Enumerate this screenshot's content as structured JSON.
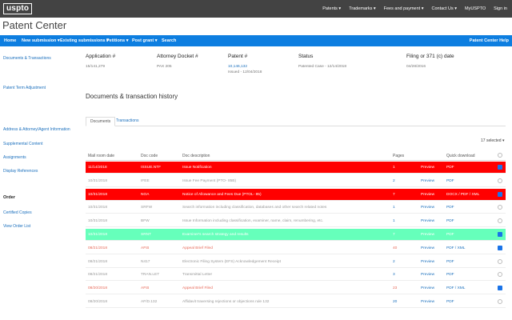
{
  "header": {
    "logo": "uspto",
    "nav": [
      "Patents ▾",
      "Trademarks ▾",
      "Fees and payment ▾",
      "Contact Us ▾",
      "MyUSPTO",
      "Sign in"
    ]
  },
  "app_title": "Patent Center",
  "mainnav": {
    "home": "Home",
    "new_submission": "New submission ▾",
    "existing_submissions": "Existing submissions ▾",
    "petitions": "Petitions ▾",
    "post_grant": "Post grant ▾",
    "search": "Search",
    "help": "Patent Center Help"
  },
  "sidebar": {
    "documents_transactions": "Documents & Transactions",
    "patent_term_adjustment": "Patent Term Adjustment",
    "address_attorney": "Address & Attorney/Agent Information",
    "supplemental_content": "Supplemental Content",
    "assignments": "Assignments",
    "display_references": "Display References",
    "order_header": "Order",
    "certified_copies": "Certified Copies",
    "view_order_list": "View Order List"
  },
  "summary": {
    "application_label": "Application #",
    "application_value": "15/141,279",
    "docket_label": "Attorney Docket #",
    "docket_value": "PAX 205",
    "patent_label": "Patent #",
    "patent_value": "10,146,132",
    "patent_issued": "Issued - 12/04/2018",
    "status_label": "Status",
    "status_value": "Patented Case - 12/14/2018",
    "filing_label": "Filing or 371 (c) date",
    "filing_value": "04/28/2016"
  },
  "section_title": "Documents & transaction history",
  "tabs": {
    "documents": "Documents",
    "transactions": "Transactions"
  },
  "selected_label": "17 selected ▾",
  "table": {
    "headers": {
      "date": "Mail room date",
      "code": "Doc code",
      "desc": "Doc description",
      "pages": "Pages",
      "download": "Quick download"
    },
    "rows": [
      {
        "date": "11/14/2018",
        "code": "ISSUE.NTF",
        "desc": "Issue Notification",
        "pages": "1",
        "preview": "Preview",
        "dl": "PDF",
        "style": "red",
        "checked": true
      },
      {
        "date": "10/31/2018",
        "code": "IFEE",
        "desc": "Issue Fee Payment (PTO- 85B)",
        "pages": "2",
        "preview": "Preview",
        "dl": "PDF",
        "style": "normal",
        "checked": false
      },
      {
        "date": "10/31/2018",
        "code": "NOA",
        "desc": "Notice of Allowance and Fees Due (PTOL- 85)",
        "pages": "7",
        "preview": "Preview",
        "dl": "DOCX / PDF / XML",
        "style": "red",
        "checked": true
      },
      {
        "date": "10/31/2018",
        "code": "SRFW",
        "desc": "Search information including classification, databases and other search related notes",
        "pages": "1",
        "preview": "Preview",
        "dl": "PDF",
        "style": "normal",
        "checked": false
      },
      {
        "date": "10/31/2018",
        "code": "BFW",
        "desc": "Issue Information including classification, examiner, name, claim, renumbering, etc.",
        "pages": "1",
        "preview": "Preview",
        "dl": "PDF",
        "style": "normal",
        "checked": false
      },
      {
        "date": "10/31/2018",
        "code": "SRNT",
        "desc": "Examiner's search strategy and results",
        "pages": "7",
        "preview": "Preview",
        "dl": "PDF",
        "style": "green",
        "checked": true
      },
      {
        "date": "08/21/2018",
        "code": "AP.B",
        "desc": "Appeal Brief Filed",
        "pages": "40",
        "preview": "Preview",
        "dl": "PDF / XML",
        "style": "appeal",
        "checked": true
      },
      {
        "date": "08/21/2018",
        "code": "N417",
        "desc": "Electronic Filing System (EFS) Acknowledgement Receipt",
        "pages": "2",
        "preview": "Preview",
        "dl": "PDF",
        "style": "normal",
        "checked": false
      },
      {
        "date": "08/21/2018",
        "code": "TRAN.LET",
        "desc": "Transmittal Letter",
        "pages": "3",
        "preview": "Preview",
        "dl": "PDF",
        "style": "normal",
        "checked": false
      },
      {
        "date": "08/20/2018",
        "code": "AP.B",
        "desc": "Appeal Brief Filed",
        "pages": "23",
        "preview": "Preview",
        "dl": "PDF / XML",
        "style": "appeal",
        "checked": true
      },
      {
        "date": "08/20/2018",
        "code": "AF/D.132",
        "desc": "Affidavit traversing rejections or objections rule 132",
        "pages": "20",
        "preview": "Preview",
        "dl": "PDF",
        "style": "normal",
        "checked": false
      }
    ]
  }
}
